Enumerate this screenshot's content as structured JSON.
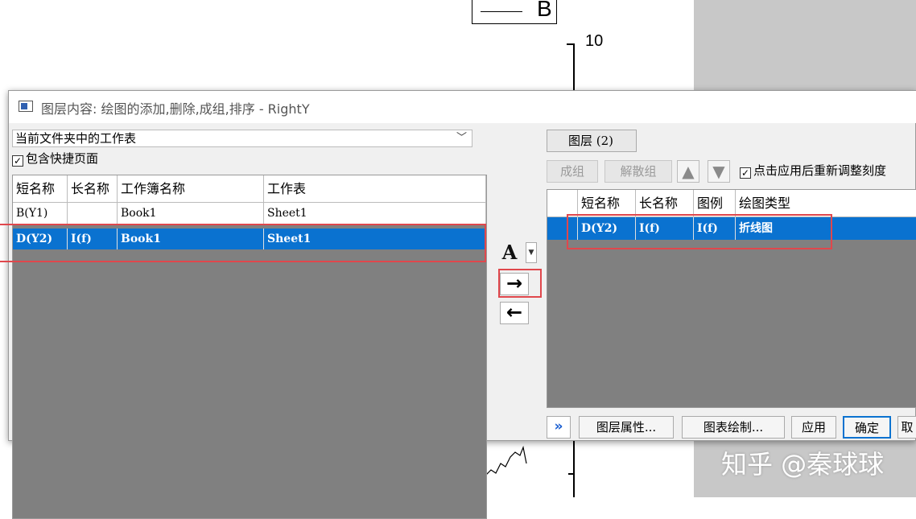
{
  "background": {
    "legend_label": "B",
    "tick_label": "10",
    "watermark": "知乎 @秦球球",
    "panel_color": "#c8c8c8"
  },
  "dialog": {
    "title": "图层内容: 绘图的添加,删除,成组,排序 - RightY",
    "left": {
      "dropdown_value": "当前文件夹中的工作表",
      "include_shortcut_label": "包含快捷页面",
      "include_shortcut_checked": true,
      "columns": [
        "短名称",
        "长名称",
        "工作簿名称",
        "工作表"
      ],
      "rows": [
        {
          "short": "B(Y1)",
          "long": "",
          "book": "Book1",
          "sheet": "Sheet1",
          "selected": false
        },
        {
          "short": "D(Y2)",
          "long": "I(f)",
          "book": "Book1",
          "sheet": "Sheet1",
          "selected": true
        }
      ]
    },
    "center": {
      "font_button": "A",
      "add_arrow": "→",
      "remove_arrow": "←"
    },
    "right": {
      "layer_tab": "图层 (2)",
      "group_button": "成组",
      "ungroup_button": "解散组",
      "rescale_label": "点击应用后重新调整刻度",
      "rescale_checked": true,
      "columns": [
        "短名称",
        "长名称",
        "图例",
        "绘图类型"
      ],
      "rows": [
        {
          "short": "D(Y2)",
          "long": "I(f)",
          "legend": "I(f)",
          "type": "折线图",
          "selected": true
        }
      ]
    },
    "footer": {
      "expand": "»",
      "layer_props": "图层属性...",
      "plot_setup": "图表绘制...",
      "apply": "应用",
      "ok": "确定",
      "cancel_partial": "取"
    },
    "accent_color": "#0a72d0",
    "highlight_color": "#e0474c"
  }
}
